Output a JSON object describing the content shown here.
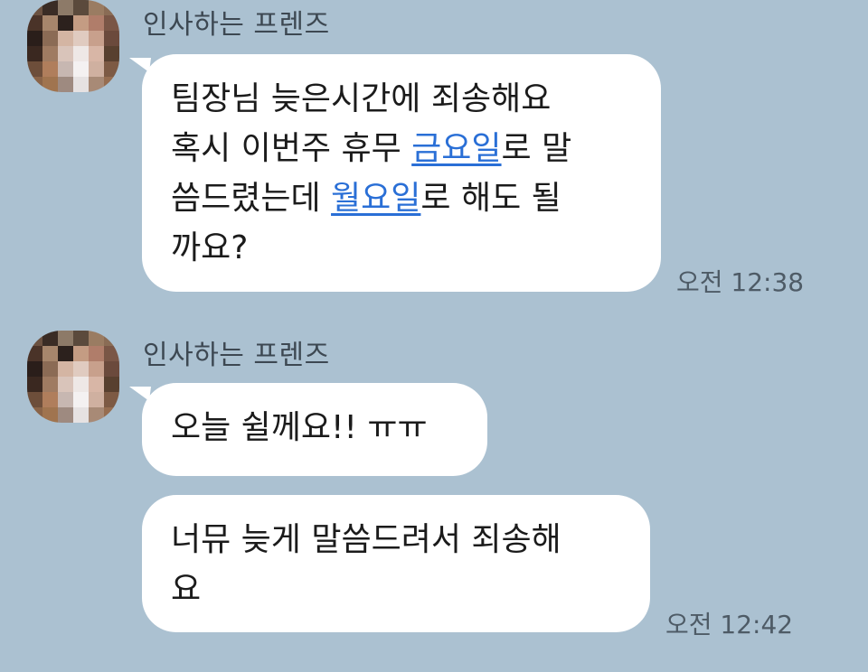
{
  "messages": [
    {
      "sender": "인사하는 프렌즈",
      "avatar_icon": "pixelated-profile-icon",
      "bubbles": [
        {
          "segments": [
            {
              "text": "팀장님 늦은시간에 죄송해요",
              "br": true
            },
            {
              "text": "혹시 이번주 휴무 "
            },
            {
              "text": "금요일",
              "link": true
            },
            {
              "text": "로 말",
              "br": true
            },
            {
              "text": "씀드렸는데 "
            },
            {
              "text": "월요일",
              "link": true
            },
            {
              "text": "로 해도 될",
              "br": true
            },
            {
              "text": "까요?"
            }
          ]
        }
      ],
      "time": "오전 12:38"
    },
    {
      "sender": "인사하는 프렌즈",
      "avatar_icon": "pixelated-profile-icon",
      "bubbles": [
        {
          "segments": [
            {
              "text": "오늘 쉴께요!! ㅠㅠ"
            }
          ]
        },
        {
          "segments": [
            {
              "text": "너뮤 늦게 말씀드려서 죄송해",
              "br": true
            },
            {
              "text": "요"
            }
          ]
        }
      ],
      "time": "오전 12:42"
    }
  ],
  "colors": {
    "background": "#abc1d1",
    "bubble": "#ffffff",
    "link": "#2a6fd6"
  }
}
